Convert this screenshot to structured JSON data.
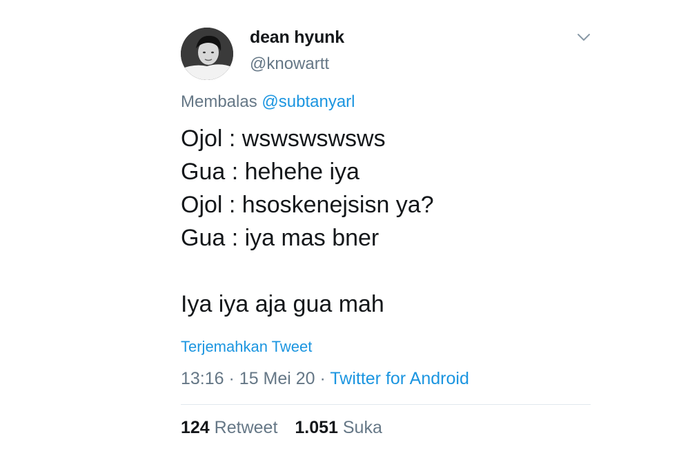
{
  "user": {
    "display_name": "dean hyunk",
    "handle": "@knowartt"
  },
  "reply_to": {
    "prefix": "Membalas",
    "mention": "@subtanyarl"
  },
  "tweet": {
    "lines": [
      "Ojol : wswswswsws",
      "Gua : hehehe iya",
      "Ojol : hsoskenejsisn ya?",
      "Gua : iya mas bner",
      "",
      "Iya iya aja gua mah"
    ],
    "translate_label": "Terjemahkan Tweet"
  },
  "meta": {
    "time": "13:16",
    "separator": "·",
    "date": "15 Mei 20",
    "source": "Twitter for Android"
  },
  "stats": {
    "retweets_count": "124",
    "retweets_label": "Retweet",
    "likes_count": "1.051",
    "likes_label": "Suka"
  },
  "icons": {
    "menu": "chevron-down-icon",
    "avatar": "avatar"
  },
  "colors": {
    "link": "#1b95e0",
    "secondary_text": "#657786",
    "primary_text": "#14171a",
    "divider": "#e1e8ed",
    "chevron": "#8899a6"
  }
}
